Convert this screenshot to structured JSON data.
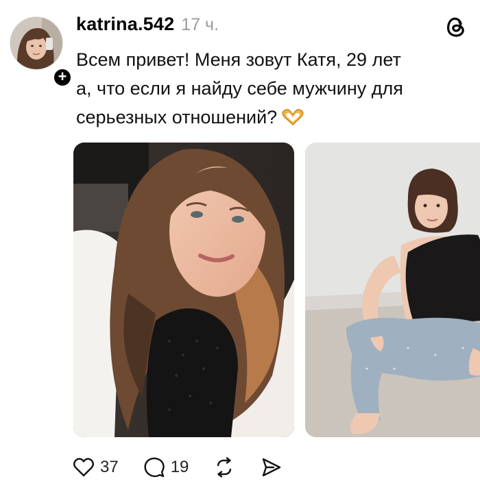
{
  "post": {
    "username": "katrina.542",
    "timestamp": "17 ч.",
    "text_lines": [
      "Всем привет! Меня зовут Катя, 29 лет",
      "а, что если я найду себе мужчину для",
      "серьезных отношений?"
    ],
    "emoji_icon": "heart-hands-emoji",
    "follow_symbol": "+",
    "images": [
      {
        "name": "selfie-photo"
      },
      {
        "name": "sitting-photo"
      }
    ]
  },
  "actions": {
    "like_count": "37",
    "reply_count": "19",
    "like_icon": "heart-icon",
    "reply_icon": "comment-bubble-icon",
    "repost_icon": "repost-icon",
    "share_icon": "send-icon"
  },
  "colors": {
    "text": "#111111",
    "muted": "#9a9a9a",
    "background": "#ffffff"
  }
}
